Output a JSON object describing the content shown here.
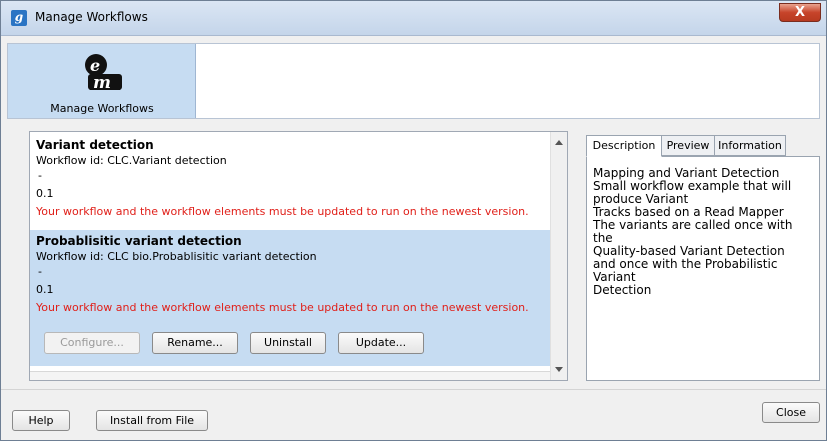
{
  "window": {
    "title": "Manage Workflows",
    "app_icon_glyph": "g",
    "close_glyph": "X"
  },
  "iconbar": {
    "logo_top": "e",
    "logo_bottom": "m",
    "label": "Manage Workflows"
  },
  "workflows": [
    {
      "name": "Variant detection",
      "id_line": "Workflow id: CLC.Variant detection",
      "dash": "-",
      "version": "0.1",
      "warning": "Your workflow and the workflow elements must be updated to run on the newest version."
    },
    {
      "name": "Probablisitic variant detection",
      "id_line": "Workflow id: CLC bio.Probablisitic variant detection",
      "dash": "-",
      "version": "0.1",
      "warning": "Your workflow and the workflow elements must be updated to run on the newest version."
    }
  ],
  "item_buttons": {
    "configure": "Configure...",
    "rename": "Rename...",
    "uninstall": "Uninstall",
    "update": "Update..."
  },
  "tabs": [
    "Description",
    "Preview",
    "Information"
  ],
  "description": "Mapping and Variant Detection\nSmall workflow example that will\nproduce Variant\nTracks based on a Read Mapper\nThe variants are called once with\nthe\nQuality-based Variant Detection\nand once with the Probabilistic\nVariant\nDetection",
  "footer": {
    "help": "Help",
    "install": "Install from File",
    "close": "Close"
  },
  "colors": {
    "selected_row": "#c6dcf2",
    "warning": "#e0201a",
    "titlebar": "#c4d5ea"
  }
}
